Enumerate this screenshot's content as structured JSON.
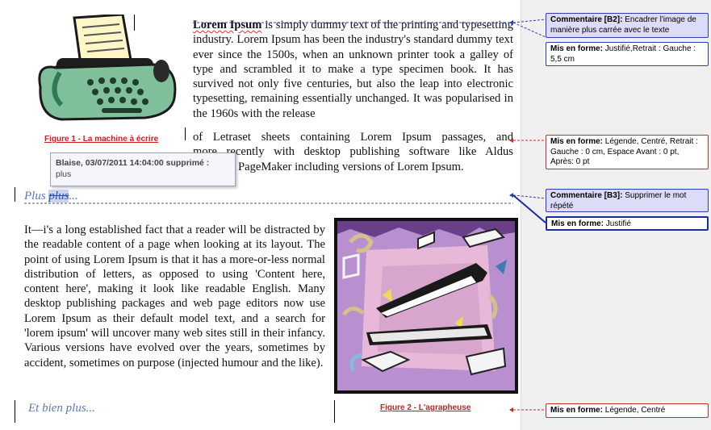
{
  "document": {
    "paragraph1_part1": {
      "lead": "Lorem Ipsum",
      "text": " is simply dummy text of the printing and typesetting industry. Lorem Ipsum has been the industry's standard dummy text ever since the 1500s, when an unknown printer took a galley of type and scrambled it to make a type specimen book. It has survived not only five centuries, but also the leap into electronic typesetting, remaining essentially unchanged. It was popularised in the 1960s with the release"
    },
    "paragraph1_part2": {
      "line1": "of Letraset sheets containing Lorem Ipsum passages, and",
      "line2": "more recently with desktop publishing software like Aldus",
      "line3": "PageMaker including versions of Lorem Ipsum."
    },
    "heading1": {
      "kept": "Plus ",
      "deleted": "plus",
      "tail": "..."
    },
    "paragraph2": "It—i's a long established fact that a reader will be distracted by the readable content of a page when looking at its layout. The point of using Lorem Ipsum is that it has a more-or-less normal distribution of letters, as opposed to using 'Content here, content here', making it look like readable English. Many desktop publishing packages and web page editors now use Lorem Ipsum as their default model text, and a search for 'lorem ipsum' will uncover many web sites still in their infancy. Various versions have evolved over the years, sometimes by accident, sometimes on purpose (injected humour and the like).",
    "heading2": "Et bien plus...",
    "figure1_caption": "Figure 1 - La machine à écrire",
    "figure2_caption": "Figure 2 - L'agrapheuse"
  },
  "tooltip": {
    "header": "Blaise, 03/07/2011 14:04:00 supprimé :",
    "body": "plus"
  },
  "balloons": [
    {
      "label": "Commentaire [B2]:",
      "text": " Encadrer l'image de manière plus carrée avec le texte"
    },
    {
      "label": "Mis en forme:",
      "text": " Justifié,Retrait : Gauche :  5,5 cm"
    },
    {
      "label": "Mis en forme:",
      "text": " Légende, Centré, Retrait : Gauche :  0 cm, Espace Avant : 0 pt, Après: 0 pt"
    },
    {
      "label": "Commentaire [B3]:",
      "text": " Supprimer le mot répété"
    },
    {
      "label": "Mis en forme:",
      "text": " Justifié"
    },
    {
      "label": "Mis en forme:",
      "text": " Légende, Centré"
    }
  ],
  "icons": {
    "figure1": "typewriter-clipart-icon",
    "figure2": "stapler-clipart-icon"
  },
  "colors": {
    "caption_red": "#d11c1c",
    "comment_fill": "#dcdcf8",
    "comment_border": "#2e3bbf",
    "format_border_red": "#c92a2a",
    "heading_blue": "#5a78b8",
    "margin_pane": "#f0f0f0"
  }
}
